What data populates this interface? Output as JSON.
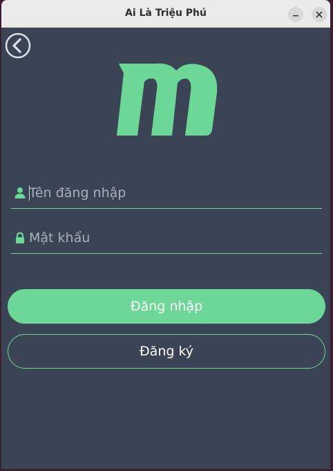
{
  "window": {
    "title": "Ai Là Triệu Phú"
  },
  "colors": {
    "accent": "#6cd797",
    "background": "#3a4454",
    "titlebar": "#ebebeb"
  },
  "icons": {
    "back": "back-arrow-circle-icon",
    "logo": "m-logo-icon",
    "user": "user-icon",
    "lock": "lock-icon",
    "minimize": "minimize-icon",
    "close": "close-icon"
  },
  "form": {
    "username": {
      "placeholder": "Tên đăng nhập",
      "value": ""
    },
    "password": {
      "placeholder": "Mật khẩu",
      "value": ""
    }
  },
  "buttons": {
    "login_label": "Đăng nhập",
    "register_label": "Đăng ký"
  }
}
